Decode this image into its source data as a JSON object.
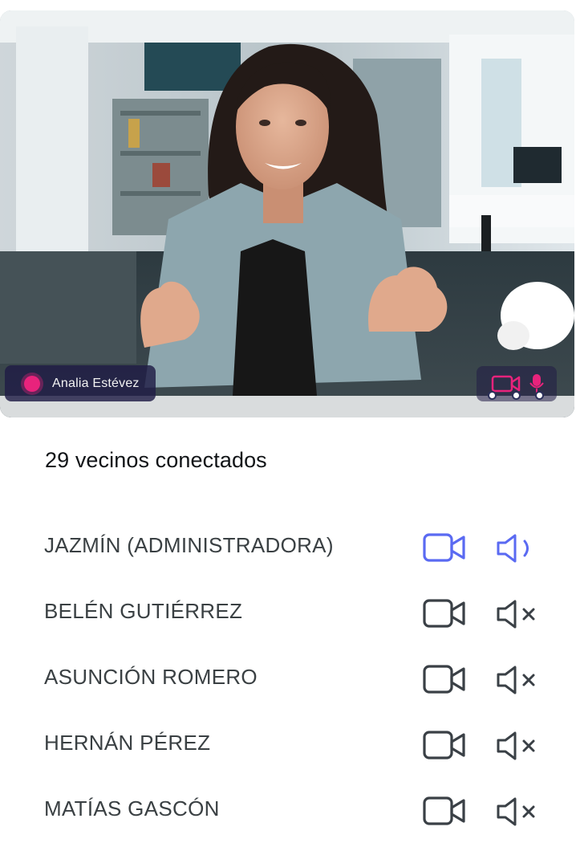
{
  "video": {
    "speaker_name": "Analia Estévez",
    "indicator_color": "#e8237c"
  },
  "summary": {
    "connected_text": "29 vecinos conectados"
  },
  "colors": {
    "active": "#5a6af2",
    "inactive": "#3a4046"
  },
  "participants": [
    {
      "name": "JAZMÍN (ADMINISTRADORA)",
      "camera": "on",
      "audio": "on",
      "camera_icon": "video-camera-icon",
      "audio_icon": "speaker-on-icon"
    },
    {
      "name": "BELÉN GUTIÉRREZ",
      "camera": "off",
      "audio": "muted",
      "camera_icon": "video-camera-icon",
      "audio_icon": "speaker-muted-icon"
    },
    {
      "name": "ASUNCIÓN ROMERO",
      "camera": "off",
      "audio": "muted",
      "camera_icon": "video-camera-icon",
      "audio_icon": "speaker-muted-icon"
    },
    {
      "name": "HERNÁN PÉREZ",
      "camera": "off",
      "audio": "muted",
      "camera_icon": "video-camera-icon",
      "audio_icon": "speaker-muted-icon"
    },
    {
      "name": "MATÍAS GASCÓN",
      "camera": "off",
      "audio": "muted",
      "camera_icon": "video-camera-icon",
      "audio_icon": "speaker-muted-icon"
    }
  ]
}
